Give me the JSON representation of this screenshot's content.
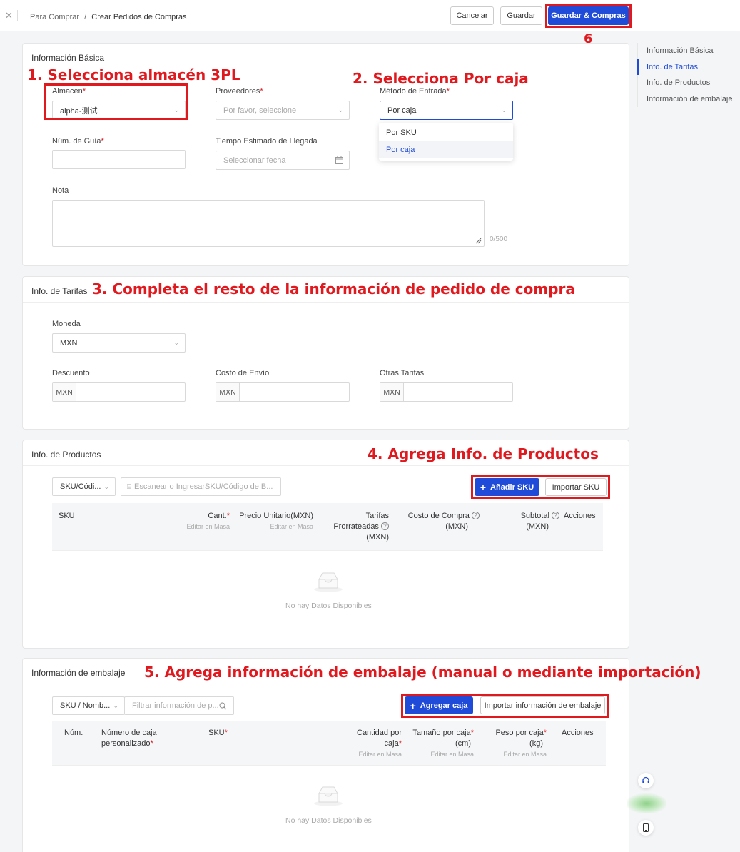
{
  "header": {
    "close_icon": "close-icon",
    "breadcrumb_parent": "Para Comprar",
    "breadcrumb_sep": "/",
    "breadcrumb_current": "Crear Pedidos de Compras",
    "cancel_label": "Cancelar",
    "save_label": "Guardar",
    "save_purchase_label": "Guardar & Compras"
  },
  "annotations": {
    "step1": "1. Selecciona almacén 3PL",
    "step2": "2. Selecciona Por caja",
    "step3": "3. Completa el resto de la información de pedido de compra",
    "step4": "4. Agrega Info. de Productos",
    "step5": "5. Agrega información de embalaje (manual o mediante importación)",
    "step6": "6"
  },
  "basic": {
    "title": "Información Básica",
    "warehouse_label": "Almacén",
    "warehouse_value": "alpha-测试",
    "supplier_label": "Proveedores",
    "supplier_placeholder": "Por favor, seleccione",
    "entry_method_label": "Método de Entrada",
    "entry_method_value": "Por caja",
    "entry_method_options": [
      "Por SKU",
      "Por caja"
    ],
    "guide_label": "Núm. de Guía",
    "eta_label": "Tiempo Estimado de Llegada",
    "eta_placeholder": "Seleccionar fecha",
    "note_label": "Nota",
    "note_counter": "0/500",
    "required_mark": "*"
  },
  "fees": {
    "title": "Info. de Tarifas",
    "currency_label": "Moneda",
    "currency_value": "MXN",
    "discount_label": "Descuento",
    "shipping_label": "Costo de Envío",
    "other_label": "Otras Tarifas",
    "prefix": "MXN"
  },
  "products": {
    "title": "Info. de Productos",
    "filter_select": "SKU/Códi...",
    "scan_placeholder": "Escanear o IngresarSKU/Código de B...",
    "add_sku_label": "Añadir SKU",
    "import_sku_label": "Importar SKU",
    "columns": {
      "sku": "SKU",
      "qty": "Cant.",
      "qty_sub": "Editar en Masa",
      "unit_price": "Precio Unitario(MXN)",
      "unit_price_sub": "Editar en Masa",
      "prorated_1": "Tarifas",
      "prorated_2": "Prorrateadas",
      "prorated_3": "(MXN)",
      "purchase_cost_1": "Costo de Compra",
      "purchase_cost_2": "(MXN)",
      "subtotal_1": "Subtotal",
      "subtotal_2": "(MXN)",
      "actions": "Acciones"
    },
    "empty_text": "No hay Datos Disponibles"
  },
  "packing": {
    "title": "Información de embalaje",
    "filter_select": "SKU / Nomb...",
    "filter_placeholder": "Filtrar información de p...",
    "add_box_label": "Agregar caja",
    "import_label": "Importar información de embalaje",
    "columns": {
      "num": "Núm.",
      "box_num_1": "Número de caja",
      "box_num_2": "personalizado",
      "sku": "SKU",
      "qty_1": "Cantidad por",
      "qty_2": "caja",
      "qty_sub": "Editar en Masa",
      "size_1": "Tamaño por caja",
      "size_2": "(cm)",
      "size_sub": "Editar en Masa",
      "weight_1": "Peso por caja",
      "weight_2": "(kg)",
      "weight_sub": "Editar en Masa",
      "actions": "Acciones"
    },
    "empty_text": "No hay Datos Disponibles"
  },
  "side_nav": {
    "items": [
      "Información Básica",
      "Info. de Tarifas",
      "Info. de Productos",
      "Información de embalaje"
    ]
  },
  "colors": {
    "primary": "#1f4bd8",
    "annotation_red": "#e0191f"
  }
}
